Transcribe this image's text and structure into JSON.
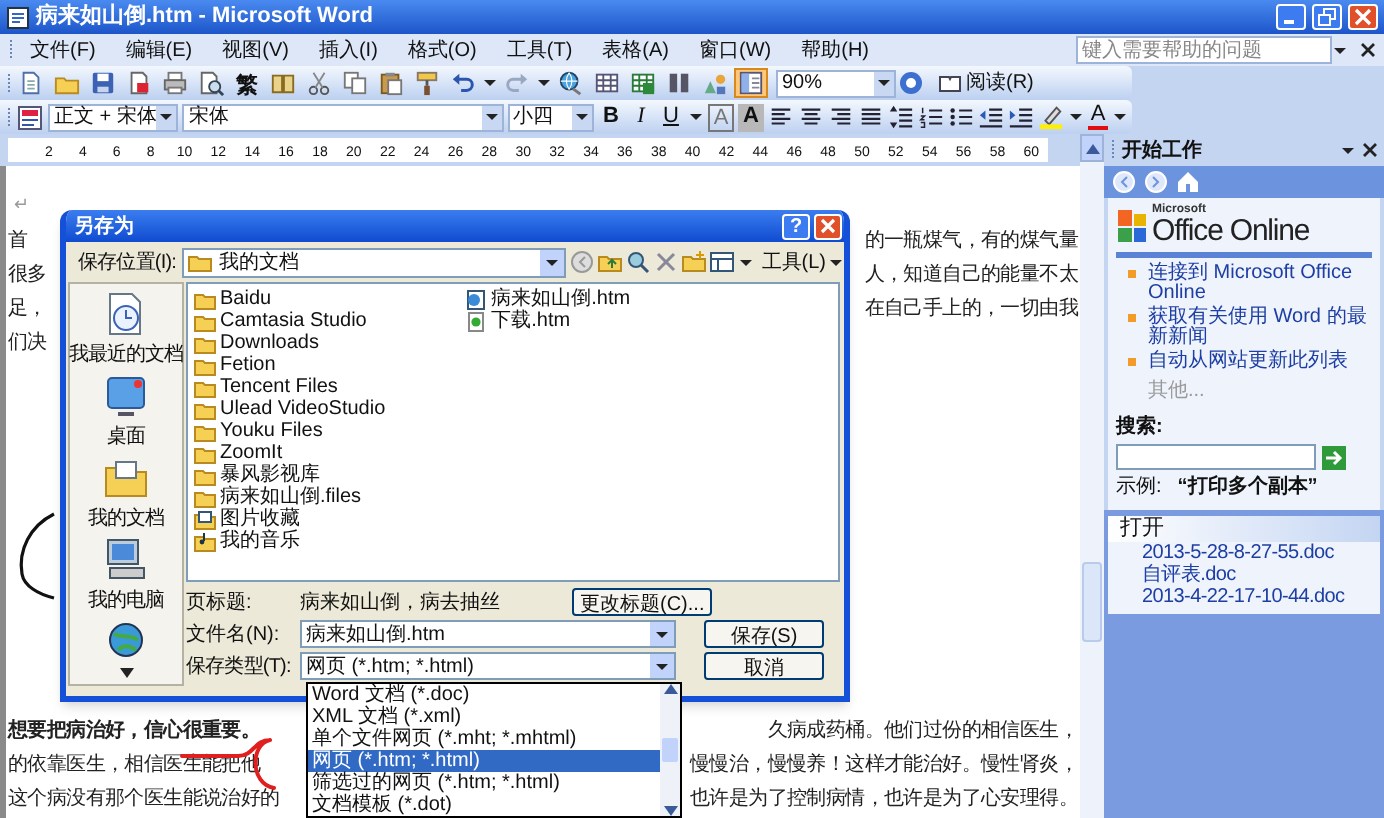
{
  "window": {
    "title": "病来如山倒.htm - Microsoft Word"
  },
  "menu": [
    "文件(F)",
    "编辑(E)",
    "视图(V)",
    "插入(I)",
    "格式(O)",
    "工具(T)",
    "表格(A)",
    "窗口(W)",
    "帮助(H)"
  ],
  "help_box": {
    "placeholder": "键入需要帮助的问题"
  },
  "standard_toolbar": {
    "buttons": [
      {
        "kind": "new",
        "selected": false
      },
      {
        "kind": "open",
        "selected": false
      },
      {
        "kind": "save",
        "selected": false
      },
      {
        "kind": "stamp",
        "selected": false
      },
      {
        "kind": "print",
        "selected": false
      },
      {
        "kind": "preview",
        "selected": false
      },
      {
        "kind": "glyph",
        "label": "繁",
        "selected": false
      },
      {
        "kind": "research",
        "selected": false
      },
      {
        "kind": "cut",
        "selected": false
      },
      {
        "kind": "copy",
        "selected": false
      },
      {
        "kind": "paste",
        "selected": false
      },
      {
        "kind": "painter",
        "selected": false
      },
      {
        "kind": "undo",
        "selected": false
      },
      {
        "kind": "redo",
        "selected": false
      },
      {
        "kind": "hyperlink",
        "selected": false
      },
      {
        "kind": "table",
        "selected": false
      },
      {
        "kind": "excel",
        "selected": false
      },
      {
        "kind": "columns",
        "selected": false
      },
      {
        "kind": "drawing",
        "selected": false
      },
      {
        "kind": "docmap",
        "selected": true
      }
    ],
    "zoom": "90%",
    "read_button": "阅读(R)"
  },
  "formatting_toolbar": {
    "style": "正文 + 宋体",
    "font": "宋体",
    "size": "小四",
    "format_buttons": [
      {
        "kind": "bold",
        "label": "B"
      },
      {
        "kind": "italic",
        "label": "I"
      },
      {
        "kind": "underline",
        "label": "U"
      },
      {
        "kind": "border",
        "label": "A"
      },
      {
        "kind": "shading",
        "label": "A"
      }
    ],
    "font_color_button": "A"
  },
  "ruler": [
    "2",
    "4",
    "6",
    "8",
    "10",
    "12",
    "14",
    "16",
    "18",
    "20",
    "22",
    "24",
    "26",
    "28",
    "30",
    "32",
    "34",
    "36",
    "38",
    "40",
    "42",
    "44",
    "46",
    "48",
    "50",
    "52",
    "54",
    "56",
    "58",
    "60"
  ],
  "document": {
    "paragraph_mark": "↵",
    "upper_lines": [
      {
        "left": "首",
        "right": "的一瓶煤气，有的煤气量"
      },
      {
        "left": "很多",
        "right": "人，知道自己的能量不太"
      },
      {
        "left": "足，",
        "right": "在自己手上的，一切由我"
      },
      {
        "left": "们决"
      }
    ],
    "lower_lines": [
      {
        "left": "想要把病治好，信心很重要。",
        "bold": true,
        "right": "久病成药桶。他们过份的相信医生，"
      },
      {
        "left": "的依靠医生，相信医生能把他",
        "bold": false,
        "right": "慢慢治，慢慢养！这样才能治好。慢性肾炎，"
      },
      {
        "left": "这个病没有那个医生能说治好的",
        "bold": false,
        "right": "也许是为了控制病情，也许是为了心安理得。"
      }
    ]
  },
  "dialog": {
    "title": "另存为",
    "help_button": "?",
    "location_label": "保存位置(I):",
    "location": "我的文档",
    "tools_menu": "工具(L)",
    "places": [
      {
        "kind": "recent",
        "label": "我最近的文档"
      },
      {
        "kind": "desktop",
        "label": "桌面"
      },
      {
        "kind": "documents",
        "label": "我的文档"
      },
      {
        "kind": "computer",
        "label": "我的电脑"
      },
      {
        "kind": "network"
      }
    ],
    "files": [
      {
        "kind": "folder",
        "name": "Baidu"
      },
      {
        "kind": "folder",
        "name": "Camtasia Studio"
      },
      {
        "kind": "folder",
        "name": "Downloads"
      },
      {
        "kind": "folder",
        "name": "Fetion"
      },
      {
        "kind": "folder",
        "name": "Tencent Files"
      },
      {
        "kind": "folder",
        "name": "Ulead VideoStudio"
      },
      {
        "kind": "folder",
        "name": "Youku Files"
      },
      {
        "kind": "folder",
        "name": "ZoomIt"
      },
      {
        "kind": "folder",
        "name": "暴风影视库"
      },
      {
        "kind": "folder",
        "name": "病来如山倒.files"
      },
      {
        "kind": "pictures",
        "name": "图片收藏"
      },
      {
        "kind": "music",
        "name": "我的音乐"
      },
      {
        "kind": "webdoc",
        "name": "病来如山倒.htm"
      },
      {
        "kind": "htm",
        "name": "下载.htm"
      }
    ],
    "page_title_label": "页标题:",
    "page_title": "病来如山倒，病去抽丝",
    "change_title_button": "更改标题(C)...",
    "file_name_label": "文件名(N):",
    "file_name": "病来如山倒.htm",
    "file_type_label": "保存类型(T):",
    "file_type": "网页 (*.htm; *.html)",
    "save_button": "保存(S)",
    "cancel_button": "取消"
  },
  "type_dropdown": {
    "items": [
      {
        "label": "Word 文档 (*.doc)",
        "selected": false
      },
      {
        "label": "XML 文档 (*.xml)",
        "selected": false
      },
      {
        "label": "单个文件网页 (*.mht; *.mhtml)",
        "selected": false
      },
      {
        "label": "网页 (*.htm; *.html)",
        "selected": true
      },
      {
        "label": "筛选过的网页 (*.htm; *.html)",
        "selected": false
      },
      {
        "label": "文档模板 (*.dot)",
        "selected": false
      }
    ]
  },
  "task_pane": {
    "title": "开始工作",
    "logo_small": "Microsoft",
    "logo": "Office Online",
    "links": [
      "连接到 Microsoft Office Online",
      "获取有关使用 Word 的最新新闻",
      "自动从网站更新此列表"
    ],
    "more": "其他...",
    "search_label": "搜索:",
    "example_label": "示例:",
    "example": "“打印多个副本”",
    "open_header": "打开",
    "recent_files": [
      "2013-5-28-8-27-55.doc",
      "自评表.doc",
      "2013-4-22-17-10-44.doc"
    ]
  }
}
